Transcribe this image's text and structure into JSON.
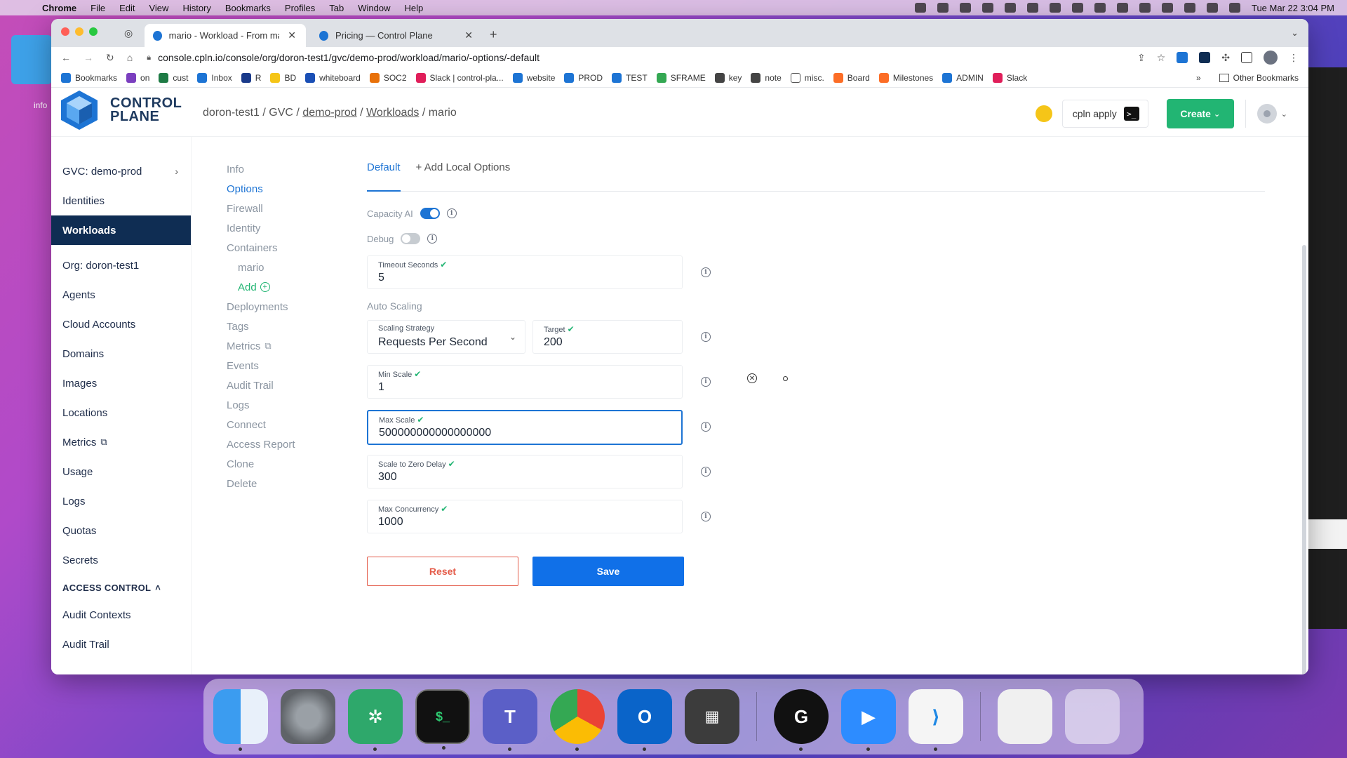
{
  "menubar": {
    "app": "Chrome",
    "items": [
      "File",
      "Edit",
      "View",
      "History",
      "Bookmarks",
      "Profiles",
      "Tab",
      "Window",
      "Help"
    ],
    "clock": "Tue Mar 22  3:04 PM"
  },
  "desktop": {
    "folder_label": "info"
  },
  "browser": {
    "tabs": [
      {
        "title": "mario - Workload - From many",
        "active": true
      },
      {
        "title": "Pricing — Control Plane",
        "active": false
      }
    ],
    "url": "console.cpln.io/console/org/doron-test1/gvc/demo-prod/workload/mario/-options/-default",
    "bookmarks": [
      "Bookmarks",
      "on",
      "cust",
      "Inbox",
      "R",
      "BD",
      "whiteboard",
      "SOC2",
      "Slack | control-pla...",
      "website",
      "PROD",
      "TEST",
      "SFRAME",
      "key",
      "note",
      "misc.",
      "Board",
      "Milestones",
      "ADMIN",
      "Slack"
    ],
    "bookmarks_more": "»",
    "other_bookmarks": "Other Bookmarks"
  },
  "app": {
    "logo_line1": "CONTROL",
    "logo_line2": "PLANE",
    "breadcrumb": {
      "org": "doron-test1",
      "sep": "/",
      "gvc_label": "GVC",
      "gvc": "demo-prod",
      "workloads": "Workloads",
      "workload": "mario"
    },
    "cpln_apply": "cpln apply",
    "terminal_glyph": ">_",
    "create": "Create",
    "create_caret": "⌄"
  },
  "sidebar": {
    "items": [
      {
        "label": "GVC: demo-prod",
        "chevron": "›"
      },
      {
        "label": "Identities"
      },
      {
        "label": "Workloads",
        "active": true
      },
      {
        "label": "Org: doron-test1"
      },
      {
        "label": "Agents"
      },
      {
        "label": "Cloud Accounts"
      },
      {
        "label": "Domains"
      },
      {
        "label": "Images"
      },
      {
        "label": "Locations"
      },
      {
        "label": "Metrics",
        "external": true
      },
      {
        "label": "Usage"
      },
      {
        "label": "Logs"
      },
      {
        "label": "Quotas"
      },
      {
        "label": "Secrets"
      }
    ],
    "section": "ACCESS CONTROL",
    "section_caret": "˄",
    "section_items": [
      "Audit Contexts",
      "Audit Trail"
    ]
  },
  "subnav": {
    "items": [
      "Info",
      "Options",
      "Firewall",
      "Identity",
      "Containers",
      "mario",
      "Add",
      "Deployments",
      "Tags",
      "Metrics",
      "Events",
      "Audit Trail",
      "Logs",
      "Connect",
      "Access Report",
      "Clone",
      "Delete"
    ],
    "active": "Options"
  },
  "form": {
    "tabs": [
      "Default",
      "+ Add Local Options"
    ],
    "capacity_ai": {
      "label": "Capacity AI",
      "on": true
    },
    "debug": {
      "label": "Debug",
      "on": false
    },
    "timeout": {
      "label": "Timeout Seconds",
      "value": "5"
    },
    "auto_scaling_label": "Auto Scaling",
    "scaling_strategy": {
      "label": "Scaling Strategy",
      "value": "Requests Per Second"
    },
    "target": {
      "label": "Target",
      "value": "200"
    },
    "min_scale": {
      "label": "Min Scale",
      "value": "1"
    },
    "max_scale": {
      "label": "Max Scale",
      "value": "500000000000000000"
    },
    "scale_to_zero": {
      "label": "Scale to Zero Delay",
      "value": "300"
    },
    "max_concurrency": {
      "label": "Max Concurrency",
      "value": "1000"
    },
    "reset": "Reset",
    "save": "Save",
    "check": "✔",
    "info_glyph": "i"
  },
  "colors": {
    "accent": "#1d74d4",
    "nav_active_bg": "#0f2d53",
    "create_green": "#22b573",
    "reset_red": "#e45c4a",
    "save_blue": "#1070e8"
  }
}
